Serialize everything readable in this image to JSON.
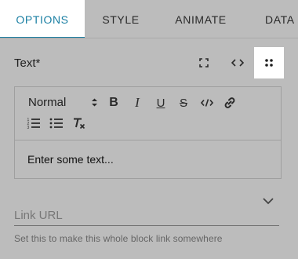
{
  "tabs": [
    {
      "label": "OPTIONS",
      "active": true
    },
    {
      "label": "STYLE",
      "active": false
    },
    {
      "label": "ANIMATE",
      "active": false
    },
    {
      "label": "DATA",
      "active": false
    }
  ],
  "field": {
    "label": "Text*",
    "modes": [
      "expand-icon",
      "code-icon",
      "drag-handle-icon"
    ],
    "active_mode": "drag-handle-icon"
  },
  "editor": {
    "format_selected": "Normal",
    "toolbar": {
      "bold": "B",
      "italic": "I",
      "underline": "U",
      "strike": "S"
    },
    "content": "Enter some text..."
  },
  "link": {
    "placeholder": "Link URL",
    "value": "",
    "helper": "Set this to make this whole block link somewhere"
  },
  "colors": {
    "background": "#bcbcbc",
    "accent": "#1a7fa3",
    "active_tab_bg": "#ffffff"
  }
}
